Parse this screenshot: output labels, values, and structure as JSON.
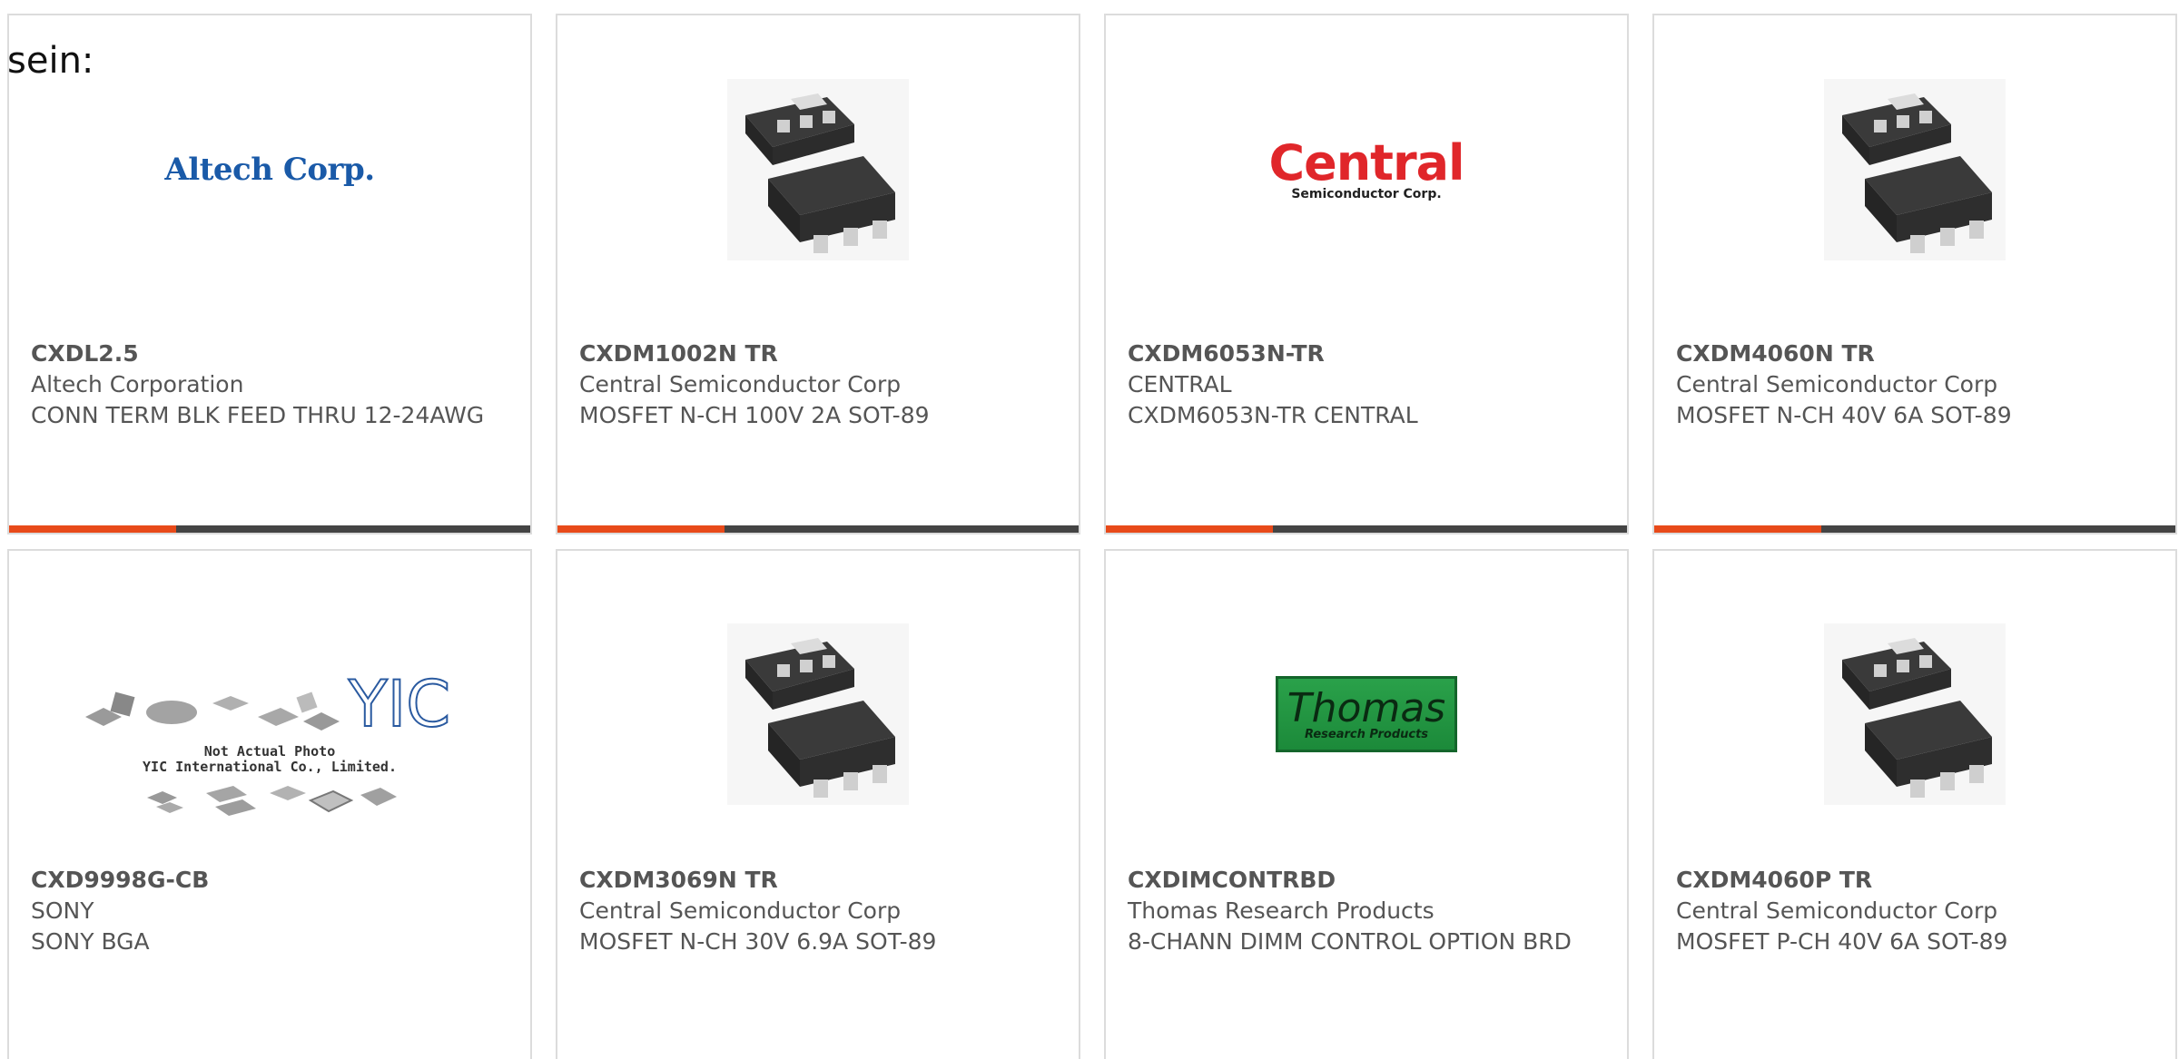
{
  "intro_text": "sein:",
  "colors": {
    "accent": "#e84a1a",
    "bar": "#444444",
    "text": "#555555",
    "border": "#dcdcdc"
  },
  "products": [
    {
      "part_number": "CXDL2.5",
      "manufacturer": "Altech Corporation",
      "description": "CONN TERM BLK FEED THRU 12-24AWG",
      "image": "altech-logo",
      "logo_text": "Altech Corp."
    },
    {
      "part_number": "CXDM1002N TR",
      "manufacturer": "Central Semiconductor Corp",
      "description": "MOSFET N-CH 100V 2A SOT-89",
      "image": "sot89-package"
    },
    {
      "part_number": "CXDM6053N-TR",
      "manufacturer": "CENTRAL",
      "description": "CXDM6053N-TR CENTRAL",
      "image": "central-logo",
      "logo_text": "Central",
      "logo_subtext": "Semiconductor Corp."
    },
    {
      "part_number": "CXDM4060N TR",
      "manufacturer": "Central Semiconductor Corp",
      "description": "MOSFET N-CH 40V 6A SOT-89",
      "image": "sot89-package"
    },
    {
      "part_number": "CXD9998G-CB",
      "manufacturer": "SONY",
      "description": "SONY BGA",
      "image": "yic-placeholder",
      "logo_text": "YIC",
      "caption_line1": "Not Actual Photo",
      "caption_line2": "YIC International Co., Limited."
    },
    {
      "part_number": "CXDM3069N TR",
      "manufacturer": "Central Semiconductor Corp",
      "description": "MOSFET N-CH 30V 6.9A SOT-89",
      "image": "sot89-package"
    },
    {
      "part_number": "CXDIMCONTRBD",
      "manufacturer": "Thomas Research Products",
      "description": "8-CHANN DIMM CONTROL OPTION BRD",
      "image": "thomas-logo",
      "logo_text": "Thomas",
      "logo_subtext": "Research Products"
    },
    {
      "part_number": "CXDM4060P TR",
      "manufacturer": "Central Semiconductor Corp",
      "description": "MOSFET P-CH 40V 6A SOT-89",
      "image": "sot89-package"
    }
  ]
}
